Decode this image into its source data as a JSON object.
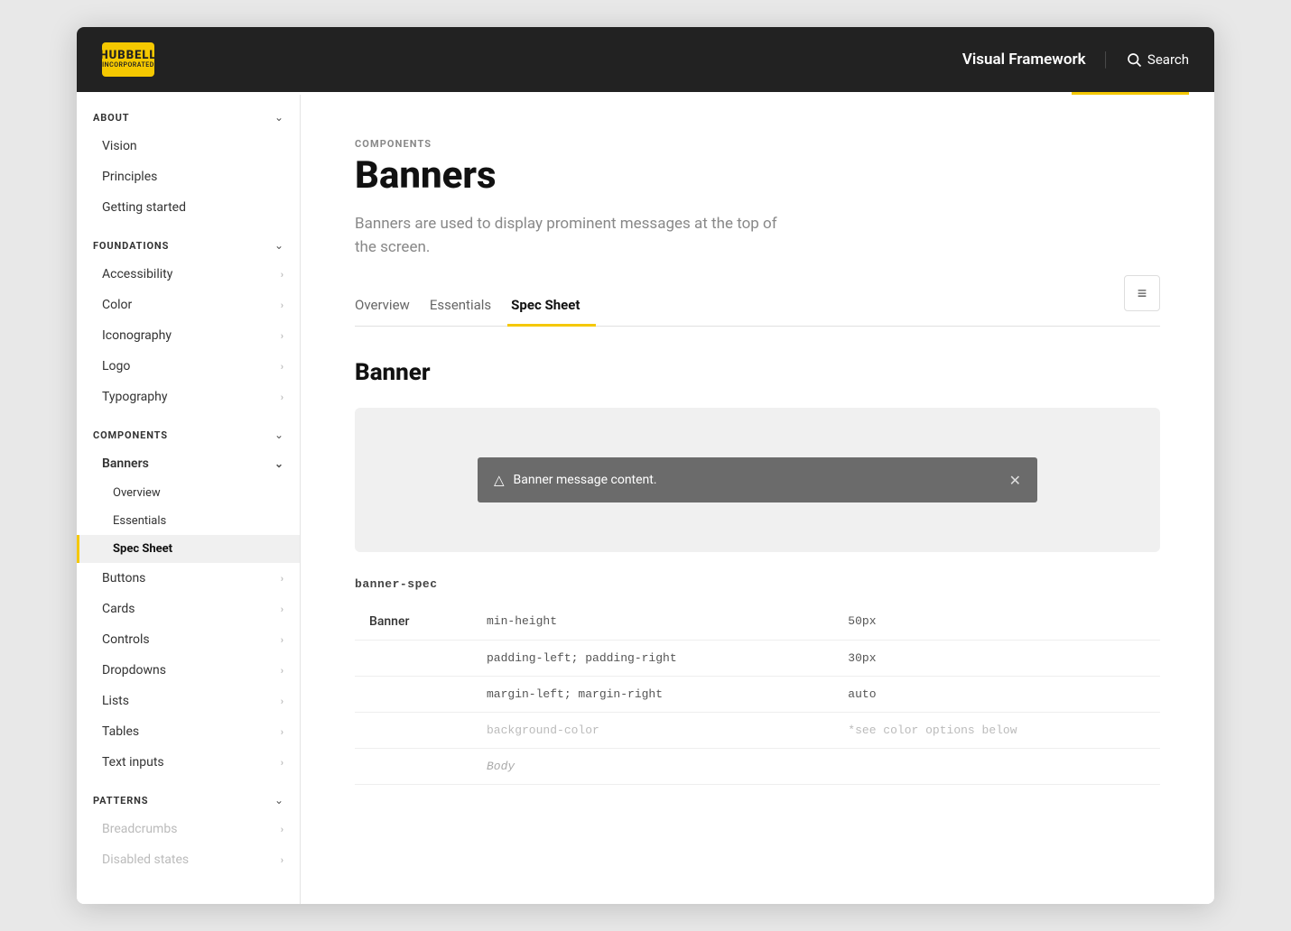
{
  "app": {
    "title": "Visual Framework",
    "search_label": "Search"
  },
  "logo": {
    "top": "HUBBELL",
    "sub": "INCORPORATED"
  },
  "sidebar": {
    "about_label": "ABOUT",
    "about_items": [
      {
        "label": "Vision"
      },
      {
        "label": "Principles"
      },
      {
        "label": "Getting started"
      }
    ],
    "foundations_label": "FOUNDATIONS",
    "foundations_items": [
      {
        "label": "Accessibility"
      },
      {
        "label": "Color"
      },
      {
        "label": "Iconography"
      },
      {
        "label": "Logo"
      },
      {
        "label": "Typography"
      }
    ],
    "components_label": "COMPONENTS",
    "banners_label": "Banners",
    "banners_sub_items": [
      {
        "label": "Overview"
      },
      {
        "label": "Essentials"
      },
      {
        "label": "Spec Sheet",
        "active": true
      }
    ],
    "components_items": [
      {
        "label": "Buttons"
      },
      {
        "label": "Cards"
      },
      {
        "label": "Controls"
      },
      {
        "label": "Dropdowns"
      },
      {
        "label": "Lists"
      },
      {
        "label": "Tables"
      },
      {
        "label": "Text inputs"
      }
    ],
    "patterns_label": "PATTERNS",
    "patterns_items": [
      {
        "label": "Breadcrumbs"
      },
      {
        "label": "Disabled states"
      }
    ]
  },
  "page": {
    "breadcrumb": "COMPONENTS",
    "title": "Banners",
    "description": "Banners are used to display prominent messages at the top of the screen.",
    "tabs": [
      {
        "label": "Overview"
      },
      {
        "label": "Essentials"
      },
      {
        "label": "Spec Sheet",
        "active": true
      }
    ],
    "section_title": "Banner",
    "banner_demo_text": "Banner message content.",
    "spec_label": "banner-spec",
    "toc_icon": "≡",
    "spec_rows": [
      {
        "component": "Banner",
        "property": "min-height",
        "value": "50px"
      },
      {
        "component": "",
        "property": "padding-left; padding-right",
        "value": "30px"
      },
      {
        "component": "",
        "property": "margin-left; margin-right",
        "value": "auto"
      },
      {
        "component": "",
        "property": "background-color",
        "value": "*see color options below"
      },
      {
        "component": "",
        "property": "Body",
        "value": ""
      }
    ]
  }
}
